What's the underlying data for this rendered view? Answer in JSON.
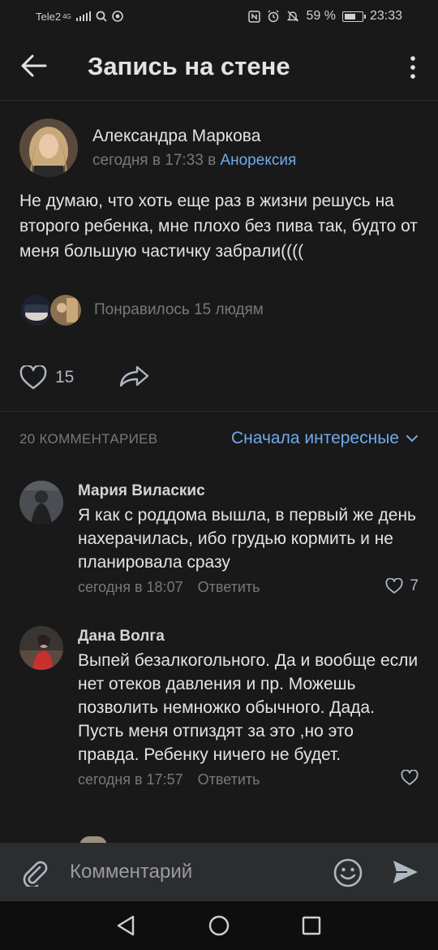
{
  "status_bar": {
    "carrier": "Tele2",
    "network": "4G",
    "battery": "59 %",
    "time": "23:33"
  },
  "header": {
    "title": "Запись на стене"
  },
  "post": {
    "author": "Александра Маркова",
    "time_prefix": "сегодня в 17:33 в",
    "group": "Анорексия",
    "text": "Не думаю, что хоть еще раз в жизни решусь на второго ребенка, мне плохо без пива так, будто от меня большую частичку забрали((((",
    "liked_by_text": "Понравилось 15 людям",
    "like_count": "15"
  },
  "comments_section": {
    "count_label": "20 КОММЕНТАРИЕВ",
    "sort_label": "Сначала интересные"
  },
  "comments": [
    {
      "name": "Мария Виласкис",
      "text": "Я как с роддома вышла, в первый же день нахерачилась, ибо грудью кормить и не планировала сразу",
      "time": "сегодня в 18:07",
      "reply": "Ответить",
      "likes": "7"
    },
    {
      "name": "Дана Волга",
      "text": "Выпей безалкогольного. Да и вообще если нет отеков давления и пр. Можешь позволить немножко обычного. Дада. Пусть меня отпиздят за это ,но это правда. Ребенку ничего не будет.",
      "time": "сегодня в 17:57",
      "reply": "Ответить",
      "likes": ""
    }
  ],
  "composer": {
    "placeholder": "Комментарий"
  },
  "colors": {
    "background": "#19191a",
    "accent": "#71aaeb",
    "secondary_text": "#76787a",
    "composer_bg": "#2c2d2e"
  }
}
